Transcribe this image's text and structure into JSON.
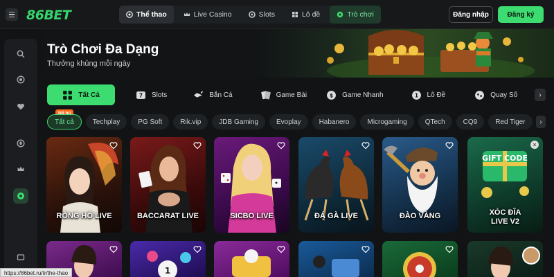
{
  "brand": {
    "logo": "86BET"
  },
  "nav": [
    {
      "label": "Thể thao",
      "icon": "soccer-ball-icon"
    },
    {
      "label": "Live Casino",
      "icon": "crown-icon"
    },
    {
      "label": "Slots",
      "icon": "slot-icon"
    },
    {
      "label": "Lô đề",
      "icon": "lottery-icon"
    },
    {
      "label": "Trò chơi",
      "icon": "gamepad-icon"
    }
  ],
  "auth": {
    "login": "Đăng nhập",
    "register": "Đăng ký"
  },
  "hero": {
    "title": "Trò Chơi Đa Dạng",
    "subtitle": "Thưởng khủng mỗi ngày"
  },
  "categories": [
    {
      "label": "Tất Cả",
      "icon": "grid-icon"
    },
    {
      "label": "Slots",
      "icon": "slot-icon"
    },
    {
      "label": "Bắn Cá",
      "icon": "fish-icon"
    },
    {
      "label": "Game Bài",
      "icon": "cards-icon"
    },
    {
      "label": "Game Nhanh",
      "icon": "fast-icon"
    },
    {
      "label": "Lô Đề",
      "icon": "lottery-icon"
    },
    {
      "label": "Quay Số",
      "icon": "dice-icon"
    }
  ],
  "providers": [
    "Tất cả",
    "Techplay",
    "PG Soft",
    "Rik.vip",
    "JDB Gaming",
    "Evoplay",
    "Habanero",
    "Microgaming",
    "QTech",
    "CQ9",
    "Red Tiger"
  ],
  "provider_badge": "Nổ hũ",
  "games": [
    {
      "title": "RỒNG HỔ LIVE"
    },
    {
      "title": "BACCARAT LIVE"
    },
    {
      "title": "SICBO LIVE"
    },
    {
      "title": "ĐÁ GÀ LIVE"
    },
    {
      "title": "ĐÀO VÀNG"
    },
    {
      "title": "XÓC ĐĨA LIVE V2",
      "line1": "XÓC ĐĨA",
      "line2": "LIVE V2",
      "art_text": "GIFT CODE"
    }
  ],
  "status_url": "https://86bet.ru/tr/the-thao",
  "colors": {
    "accent": "#3ddc70",
    "background": "#111315",
    "badge": "#ff6a1a"
  }
}
